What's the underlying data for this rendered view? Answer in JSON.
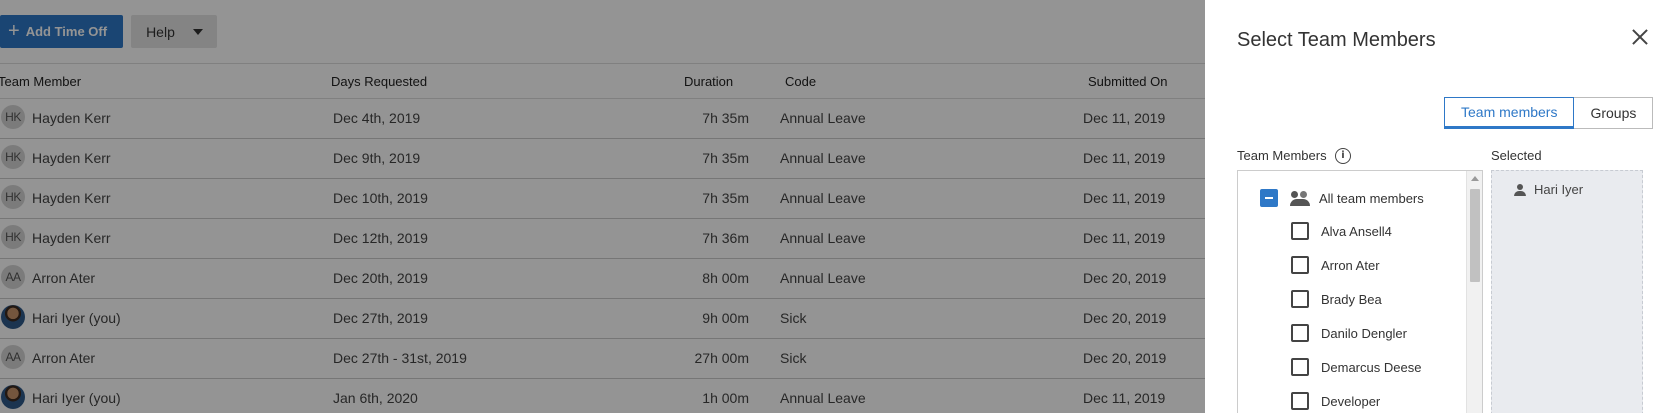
{
  "toolbar": {
    "add_time_off_label": "Add Time Off",
    "help_label": "Help"
  },
  "table": {
    "headers": {
      "member": "Team Member",
      "days": "Days Requested",
      "duration": "Duration",
      "code": "Code",
      "submitted": "Submitted On"
    },
    "rows": [
      {
        "initials": "HK",
        "member": "Hayden Kerr",
        "days": "Dec 4th, 2019",
        "duration": "7h 35m",
        "code": "Annual Leave",
        "submitted": "Dec 11, 2019"
      },
      {
        "initials": "HK",
        "member": "Hayden Kerr",
        "days": "Dec 9th, 2019",
        "duration": "7h 35m",
        "code": "Annual Leave",
        "submitted": "Dec 11, 2019"
      },
      {
        "initials": "HK",
        "member": "Hayden Kerr",
        "days": "Dec 10th, 2019",
        "duration": "7h 35m",
        "code": "Annual Leave",
        "submitted": "Dec 11, 2019"
      },
      {
        "initials": "HK",
        "member": "Hayden Kerr",
        "days": "Dec 12th, 2019",
        "duration": "7h 36m",
        "code": "Annual Leave",
        "submitted": "Dec 11, 2019"
      },
      {
        "initials": "AA",
        "member": "Arron Ater",
        "days": "Dec 20th, 2019",
        "duration": "8h 00m",
        "code": "Annual Leave",
        "submitted": "Dec 20, 2019"
      },
      {
        "initials": "",
        "member": "Hari Iyer (you)",
        "days": "Dec 27th, 2019",
        "duration": "9h 00m",
        "code": "Sick",
        "submitted": "Dec 20, 2019"
      },
      {
        "initials": "AA",
        "member": "Arron Ater",
        "days": "Dec 27th - 31st, 2019",
        "duration": "27h 00m",
        "code": "Sick",
        "submitted": "Dec 20, 2019"
      },
      {
        "initials": "",
        "member": "Hari Iyer (you)",
        "days": "Jan 6th, 2020",
        "duration": "1h 00m",
        "code": "Annual Leave",
        "submitted": "Dec 11, 2019"
      }
    ]
  },
  "panel": {
    "title": "Select Team Members",
    "tabs": {
      "team_members": "Team members",
      "groups": "Groups"
    },
    "team_members_label": "Team Members",
    "selected_label": "Selected",
    "all_label": "All team members",
    "members": [
      "Alva Ansell4",
      "Arron Ater",
      "Brady Bea",
      "Danilo Dengler",
      "Demarcus Deese",
      "Developer"
    ],
    "selected": [
      "Hari Iyer"
    ]
  }
}
